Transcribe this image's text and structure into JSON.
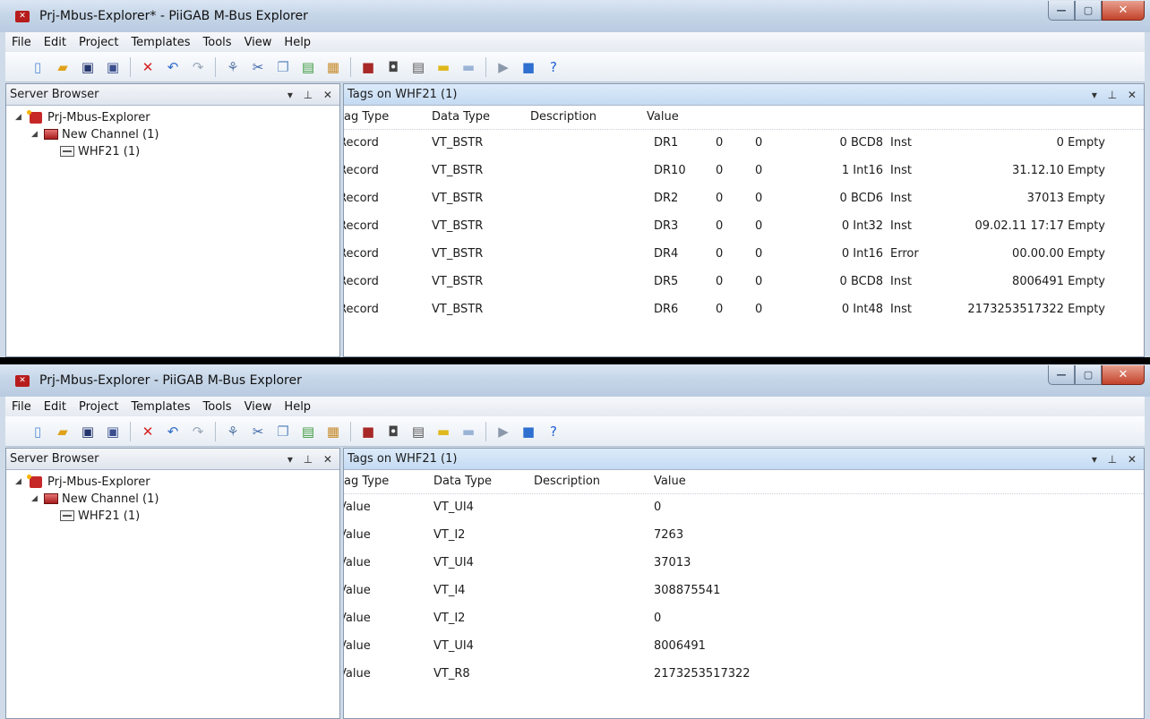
{
  "windows": [
    {
      "title": "Prj-Mbus-Explorer* - PiiGAB M-Bus Explorer",
      "server_browser": "Server Browser",
      "tags_title": "Tags on WHF21 (1)",
      "tree": [
        "Prj-Mbus-Explorer",
        "New Channel (1)",
        "WHF21 (1)"
      ],
      "columns": [
        "ag Type",
        "Data Type",
        "Description",
        "Value"
      ],
      "rows": [
        {
          "tag_type": "Record",
          "data_type": "VT_BSTR",
          "id": "DR1",
          "a": "0",
          "b": "0",
          "c": "0 BCD8",
          "d": "Inst",
          "e": "0 Empty"
        },
        {
          "tag_type": "Record",
          "data_type": "VT_BSTR",
          "id": "DR10",
          "a": "0",
          "b": "0",
          "c": "1 Int16",
          "d": "Inst",
          "e": "31.12.10 Empty"
        },
        {
          "tag_type": "Record",
          "data_type": "VT_BSTR",
          "id": "DR2",
          "a": "0",
          "b": "0",
          "c": "0 BCD6",
          "d": "Inst",
          "e": "37013 Empty"
        },
        {
          "tag_type": "Record",
          "data_type": "VT_BSTR",
          "id": "DR3",
          "a": "0",
          "b": "0",
          "c": "0 Int32",
          "d": "Inst",
          "e": "09.02.11 17:17 Empty"
        },
        {
          "tag_type": "Record",
          "data_type": "VT_BSTR",
          "id": "DR4",
          "a": "0",
          "b": "0",
          "c": "0 Int16",
          "d": "Error",
          "e": "00.00.00 Empty"
        },
        {
          "tag_type": "Record",
          "data_type": "VT_BSTR",
          "id": "DR5",
          "a": "0",
          "b": "0",
          "c": "0 BCD8",
          "d": "Inst",
          "e": "8006491 Empty"
        },
        {
          "tag_type": "Record",
          "data_type": "VT_BSTR",
          "id": "DR6",
          "a": "0",
          "b": "0",
          "c": "0 Int48",
          "d": "Inst",
          "e": "2173253517322 Empty"
        }
      ]
    },
    {
      "title": "Prj-Mbus-Explorer - PiiGAB M-Bus Explorer",
      "server_browser": "Server Browser",
      "tags_title": "Tags on WHF21 (1)",
      "tree": [
        "Prj-Mbus-Explorer",
        "New Channel (1)",
        "WHF21 (1)"
      ],
      "columns": [
        "ag Type",
        "Data Type",
        "Description",
        "Value"
      ],
      "rows": [
        {
          "tag_type": "Value",
          "data_type": "VT_UI4",
          "value": "0"
        },
        {
          "tag_type": "Value",
          "data_type": "VT_I2",
          "value": "7263"
        },
        {
          "tag_type": "Value",
          "data_type": "VT_UI4",
          "value": "37013"
        },
        {
          "tag_type": "Value",
          "data_type": "VT_I4",
          "value": "308875541"
        },
        {
          "tag_type": "Value",
          "data_type": "VT_I2",
          "value": "0"
        },
        {
          "tag_type": "Value",
          "data_type": "VT_UI4",
          "value": "8006491"
        },
        {
          "tag_type": "Value",
          "data_type": "VT_R8",
          "value": "2173253517322"
        }
      ]
    }
  ],
  "menu": [
    "File",
    "Edit",
    "Project",
    "Templates",
    "Tools",
    "View",
    "Help"
  ],
  "pane_controls": "▾ ⊥ ✕",
  "window_buttons": {
    "min": "—",
    "max": "▢",
    "close": "✕"
  },
  "toolbar_icons": [
    {
      "name": "new-icon",
      "glyph": "▯",
      "color": "#5a8fd6"
    },
    {
      "name": "open-folder-icon",
      "glyph": "▰",
      "color": "#e0a21b"
    },
    {
      "name": "save-icon",
      "glyph": "▣",
      "color": "#24366e"
    },
    {
      "name": "save-all-icon",
      "glyph": "▣",
      "color": "#3b4f8e"
    },
    {
      "sep": true
    },
    {
      "name": "delete-icon",
      "glyph": "✕",
      "color": "#d32121"
    },
    {
      "name": "undo-icon",
      "glyph": "↶",
      "color": "#2f6cc9"
    },
    {
      "name": "redo-icon",
      "glyph": "↷",
      "color": "#9aa8b8"
    },
    {
      "sep": true
    },
    {
      "name": "connect-icon",
      "glyph": "⚘",
      "color": "#5b7aa6"
    },
    {
      "name": "cut-icon",
      "glyph": "✂",
      "color": "#3b63a8"
    },
    {
      "name": "copy-icon",
      "glyph": "❐",
      "color": "#6a8fc4"
    },
    {
      "name": "paste-icon",
      "glyph": "▤",
      "color": "#3e9a3e"
    },
    {
      "name": "properties-icon",
      "glyph": "▦",
      "color": "#c78a2a"
    },
    {
      "sep": true
    },
    {
      "name": "channel-icon",
      "glyph": "■",
      "color": "#a82828"
    },
    {
      "name": "device-icon",
      "glyph": "◘",
      "color": "#444444"
    },
    {
      "name": "device-frame-icon",
      "glyph": "▤",
      "color": "#555555"
    },
    {
      "name": "tag-add-icon",
      "glyph": "▬",
      "color": "#e0b81b"
    },
    {
      "name": "tag-icon",
      "glyph": "▬",
      "color": "#9ab4d6"
    },
    {
      "sep": true
    },
    {
      "name": "play-icon",
      "glyph": "▶",
      "color": "#8a98aa"
    },
    {
      "name": "stop-icon",
      "glyph": "■",
      "color": "#2e6fd0"
    },
    {
      "name": "help-icon",
      "glyph": "?",
      "color": "#1f5fd6"
    }
  ]
}
